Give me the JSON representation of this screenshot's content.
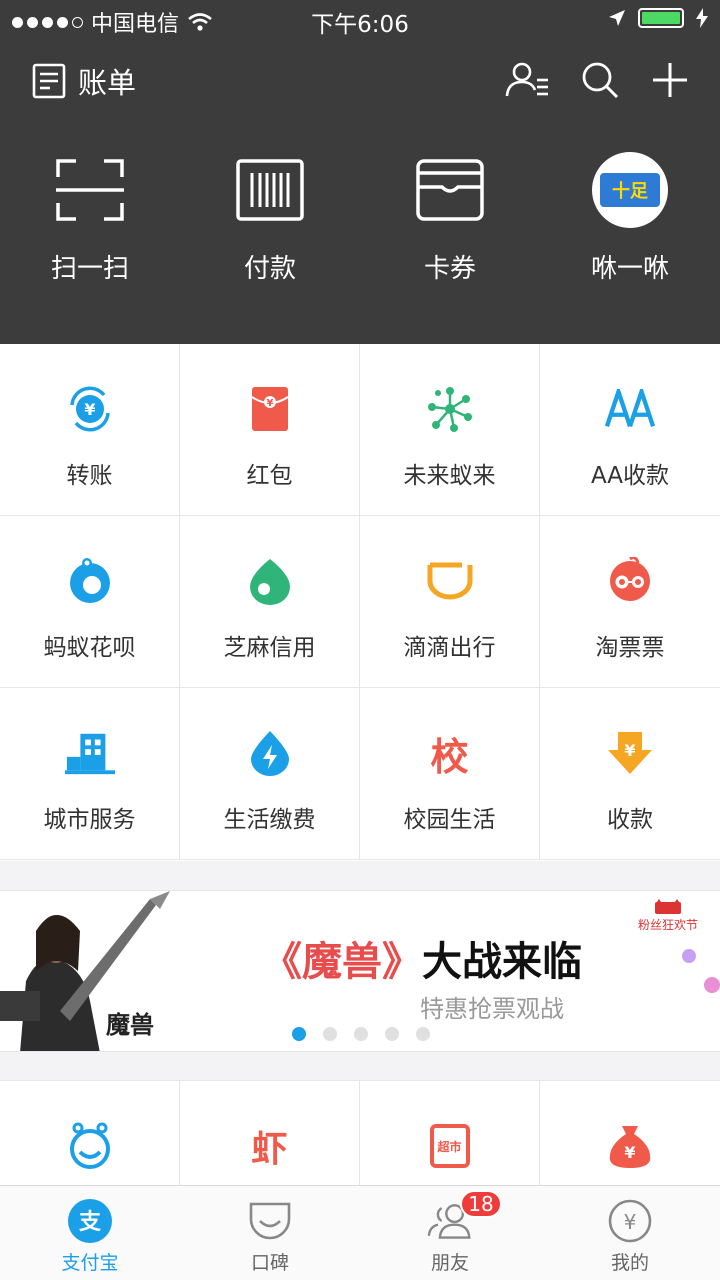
{
  "statusbar": {
    "carrier": "中国电信",
    "time": "下午6:06"
  },
  "header": {
    "bill_label": "账单"
  },
  "quick_actions": [
    {
      "label": "扫一扫",
      "icon": "scan-icon"
    },
    {
      "label": "付款",
      "icon": "barcode-icon"
    },
    {
      "label": "卡券",
      "icon": "card-wallet-icon"
    },
    {
      "label": "咻一咻",
      "icon": "avatar-icon",
      "avatar_text": "十足"
    }
  ],
  "grid": [
    {
      "label": "转账",
      "icon": "transfer-icon",
      "color": "#1ba0e8"
    },
    {
      "label": "红包",
      "icon": "red-packet-icon",
      "color": "#f05a4a"
    },
    {
      "label": "未来蚁来",
      "icon": "molecule-icon",
      "color": "#2fb47a"
    },
    {
      "label": "AA收款",
      "icon": "aa-icon",
      "color": "#1ba0e8"
    },
    {
      "label": "蚂蚁花呗",
      "icon": "huabei-icon",
      "color": "#1ba0e8"
    },
    {
      "label": "芝麻信用",
      "icon": "sesame-icon",
      "color": "#2fb47a"
    },
    {
      "label": "滴滴出行",
      "icon": "didi-icon",
      "color": "#f5a623"
    },
    {
      "label": "淘票票",
      "icon": "taopiaopiao-icon",
      "color": "#f05a4a"
    },
    {
      "label": "城市服务",
      "icon": "city-icon",
      "color": "#1ba0e8"
    },
    {
      "label": "生活缴费",
      "icon": "bolt-drop-icon",
      "color": "#1ba0e8"
    },
    {
      "label": "校园生活",
      "icon": "campus-icon",
      "glyph": "校",
      "color": "#f05a4a"
    },
    {
      "label": "收款",
      "icon": "receive-money-icon",
      "color": "#f5a623"
    }
  ],
  "banner": {
    "title_red": "《魔兽》",
    "title_black": "大战来临",
    "subtitle": "特惠抢票观战",
    "logo_text": "魔兽",
    "tag_text": "粉丝狂欢节",
    "slides": 5,
    "active_slide": 1
  },
  "grid2": [
    {
      "icon": "smile-icon",
      "color": "#1ba0e8"
    },
    {
      "icon": "xia-icon",
      "glyph": "虾",
      "color": "#f05a4a"
    },
    {
      "icon": "supermarket-icon",
      "glyph": "超市",
      "color": "#f05a4a"
    },
    {
      "icon": "money-bag-icon",
      "color": "#f05a4a"
    }
  ],
  "tabs": [
    {
      "label": "支付宝",
      "icon": "alipay-icon",
      "active": true
    },
    {
      "label": "口碑",
      "icon": "koubei-icon",
      "active": false
    },
    {
      "label": "朋友",
      "icon": "friends-icon",
      "active": false,
      "badge": "18"
    },
    {
      "label": "我的",
      "icon": "wallet-yuan-icon",
      "active": false
    }
  ],
  "colors": {
    "dark_header": "#3c3c3c",
    "accent": "#1ba0e8",
    "badge": "#f03b3b"
  }
}
